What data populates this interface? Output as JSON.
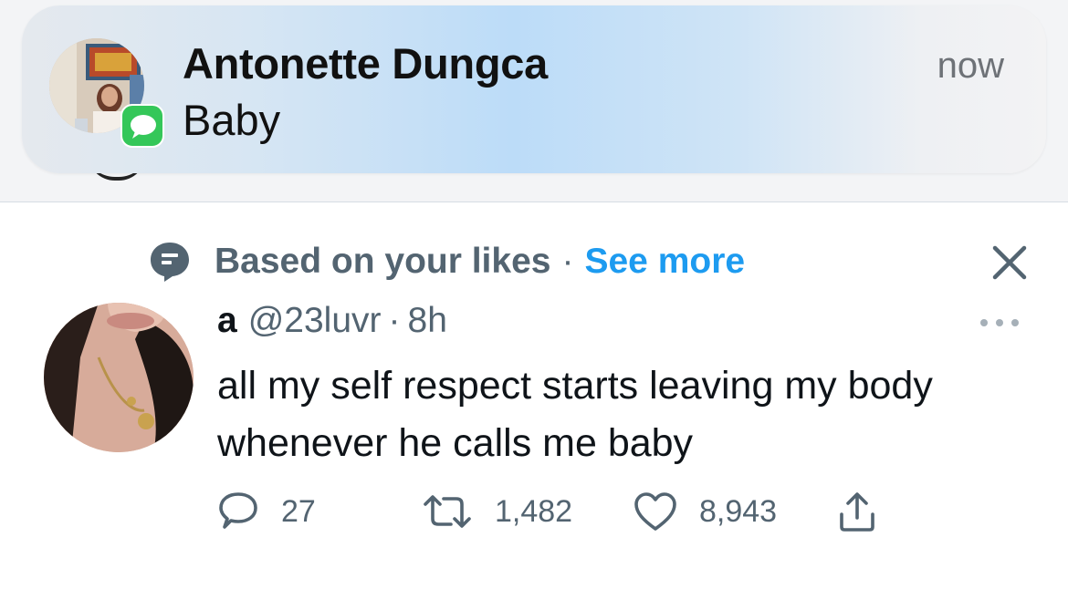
{
  "notification": {
    "sender": "Antonette Dungca",
    "message": "Baby",
    "time": "now",
    "app_icon": "messages-icon",
    "badge_color": "#34c759"
  },
  "tweet": {
    "context": {
      "label": "Based on your likes",
      "separator": "·",
      "link": "See more",
      "icon": "speech-bubble-icon"
    },
    "author": {
      "name": "a",
      "handle": "@23luvr",
      "separator": "·",
      "time": "8h"
    },
    "text": "all my self respect starts leaving my body whenever he calls me baby",
    "actions": {
      "replies": "27",
      "retweets": "1,482",
      "likes": "8,943"
    }
  },
  "colors": {
    "link": "#1d9bf0",
    "muted": "#536471",
    "text": "#0f1419"
  }
}
